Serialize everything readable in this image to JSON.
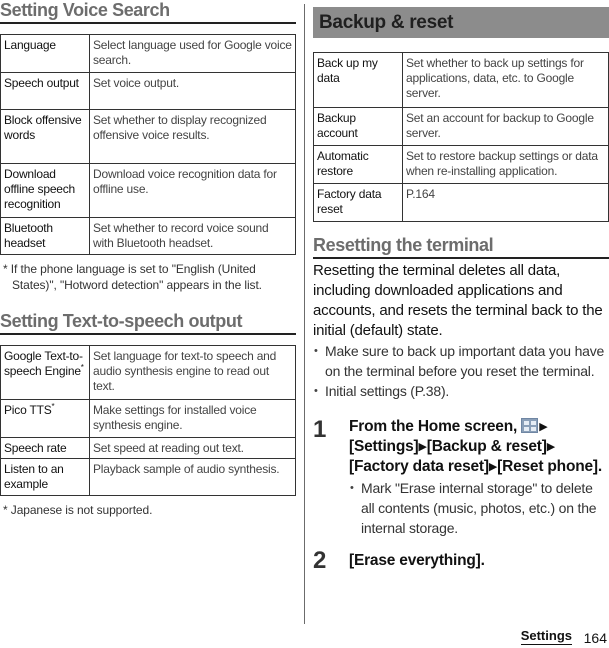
{
  "voice_search": {
    "title": "Setting Voice Search",
    "rows": [
      {
        "key": "Language",
        "value": "Select language used for Google voice search."
      },
      {
        "key": "Speech output",
        "value": "Set voice output."
      },
      {
        "key": "Block offensive words",
        "value": "Set whether to display recognized offensive voice results."
      },
      {
        "key": "Download offline speech recognition",
        "value": "Download voice recognition data for offline use."
      },
      {
        "key": "Bluetooth headset",
        "value": "Set whether to record voice sound with Bluetooth headset."
      }
    ],
    "note": "*  If the phone language is set to \"English (United States)\", \"Hotword detection\" appears in the list."
  },
  "tts": {
    "title": "Setting Text-to-speech output",
    "rows": [
      {
        "key": "Google Text-to-speech Engine",
        "star": "*",
        "value": "Set language for text-to speech and audio synthesis engine to read out text."
      },
      {
        "key": "Pico TTS",
        "star": "*",
        "value": "Make settings for installed voice synthesis engine."
      },
      {
        "key": "Speech rate",
        "star": "",
        "value": "Set speed at reading out text."
      },
      {
        "key": "Listen to an example",
        "star": "",
        "value": "Playback sample of audio synthesis."
      }
    ],
    "note": "*  Japanese is not supported."
  },
  "backup": {
    "title": "Backup & reset",
    "rows": [
      {
        "key": "Back up my data",
        "value": "Set whether to back up settings for applications, data, etc. to Google server."
      },
      {
        "key": "Backup account",
        "value": "Set an account for backup to Google server."
      },
      {
        "key": "Automatic restore",
        "value": "Set to restore backup settings or data when re-installing application."
      },
      {
        "key": "Factory data reset",
        "value": "P.164"
      }
    ]
  },
  "reset": {
    "title": "Resetting the terminal",
    "lead": "Resetting the terminal deletes all data, including downloaded applications and accounts, and resets the terminal back to the initial (default) state.",
    "bullets": [
      "Make sure to back up important data you have on the terminal before you reset the terminal.",
      "Initial settings (P.38)."
    ],
    "steps": [
      {
        "num": "1",
        "parts": [
          "From the Home screen, ",
          "[Settings]",
          "[Backup & reset]",
          "[Factory data reset]",
          "[Reset phone]."
        ],
        "icon": "apps-grid-icon",
        "arrow": "▶",
        "sub_bullet": "Mark \"Erase internal storage\" to delete all contents (music, photos, etc.) on the internal storage."
      },
      {
        "num": "2",
        "text": "[Erase everything]."
      }
    ]
  },
  "footer": {
    "section": "Settings",
    "page": "164"
  }
}
